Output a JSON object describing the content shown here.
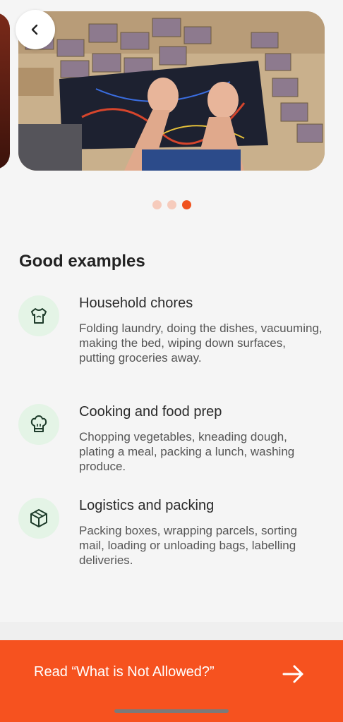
{
  "carousel": {
    "dots": [
      false,
      false,
      true
    ]
  },
  "section": {
    "title": "Good examples"
  },
  "examples": [
    {
      "icon": "tshirt-icon",
      "title": "Household chores",
      "description": "Folding laundry, doing the dishes, vacuuming, making the bed, wiping down surfaces, putting groceries away."
    },
    {
      "icon": "chef-hat-icon",
      "title": "Cooking and food prep",
      "description": "Chopping vegetables, kneading dough, plating a meal, packing a lunch, washing produce."
    },
    {
      "icon": "box-icon",
      "title": "Logistics and packing",
      "description": "Packing boxes, wrapping parcels, sorting mail, loading or unloading bags, labelling deliveries."
    }
  ],
  "cta": {
    "label": "Read “What is Not Allowed?”"
  },
  "colors": {
    "accent": "#f6521f",
    "icon_bg": "#e4f4e6",
    "icon_stroke": "#1d3b2a"
  }
}
